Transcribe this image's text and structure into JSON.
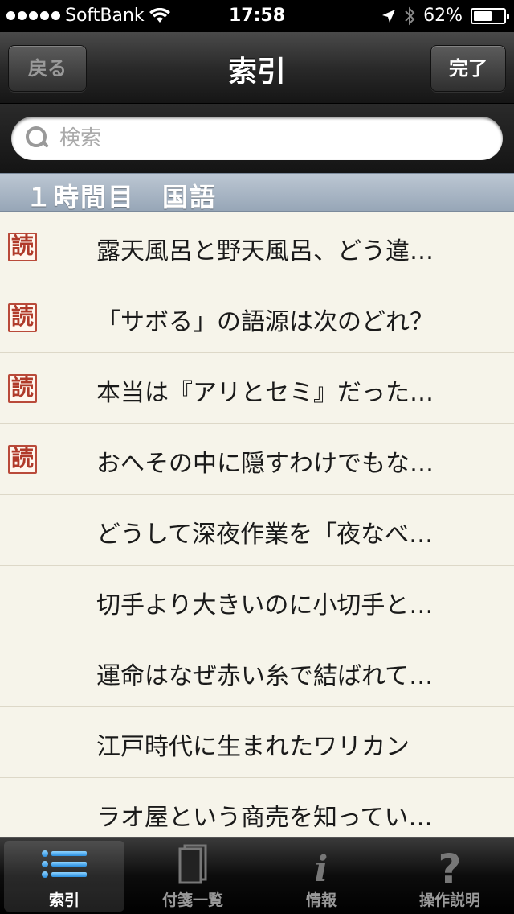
{
  "status_bar": {
    "carrier": "SoftBank",
    "time": "17:58",
    "battery_percent": "62%",
    "battery_level": 0.62
  },
  "nav": {
    "back_label": "戻る",
    "title": "索引",
    "done_label": "完了"
  },
  "search": {
    "placeholder": "検索"
  },
  "section": {
    "header": "１時間目　国語"
  },
  "badge_char": "読",
  "items": [
    {
      "title": "露天風呂と野天風呂、どう違…",
      "badge": true
    },
    {
      "title": "「サボる」の語源は次のどれ？",
      "badge": true
    },
    {
      "title": "本当は『アリとセミ』だった…",
      "badge": true
    },
    {
      "title": "おへその中に隠すわけでもな…",
      "badge": true
    },
    {
      "title": "どうして深夜作業を「夜なべ…",
      "badge": false
    },
    {
      "title": "切手より大きいのに小切手と…",
      "badge": false
    },
    {
      "title": "運命はなぜ赤い糸で結ばれて…",
      "badge": false
    },
    {
      "title": "江戸時代に生まれたワリカン",
      "badge": false
    },
    {
      "title": "ラオ屋という商売を知ってい…",
      "badge": false
    }
  ],
  "tabs": [
    {
      "label": "索引",
      "icon": "list-icon",
      "selected": true
    },
    {
      "label": "付箋一覧",
      "icon": "sticky-notes-icon",
      "selected": false
    },
    {
      "label": "情報",
      "icon": "info-icon",
      "selected": false
    },
    {
      "label": "操作説明",
      "icon": "help-icon",
      "selected": false
    }
  ],
  "colors": {
    "badge_red": "#b03a2a",
    "section_blue": "#a7b4c3",
    "list_bg": "#f6f4ea"
  }
}
